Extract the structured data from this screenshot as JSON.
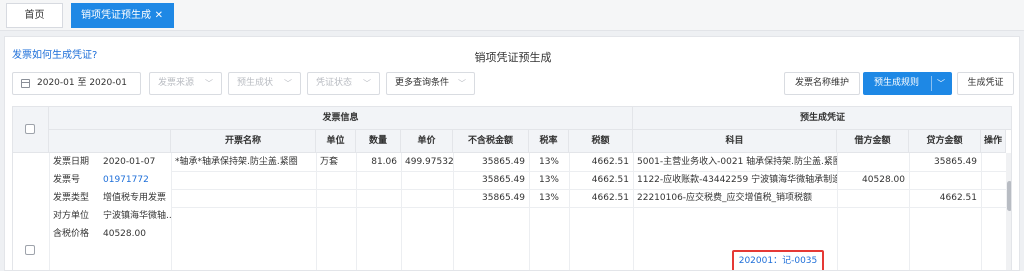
{
  "tabs": {
    "home": "首页",
    "active": "销项凭证预生成",
    "close": "✕"
  },
  "help_link": "发票如何生成凭证?",
  "page_title": "销项凭证预生成",
  "filters": {
    "date_range": "2020-01  至 2020-01",
    "invoice_source": "发票来源",
    "pregen_status": "预生成状",
    "voucher_status": "凭证状态",
    "more_query": "更多查询条件"
  },
  "buttons": {
    "name_maintenance": "发票名称维护",
    "pregen_rule": "预生成规则",
    "generate_voucher": "生成凭证"
  },
  "table": {
    "group_invoice": "发票信息",
    "group_voucher": "预生成凭证",
    "columns": {
      "item_name": "开票名称",
      "unit": "单位",
      "quantity": "数量",
      "unit_price": "单价",
      "amount_ex_tax": "不含税金额",
      "tax_rate": "税率",
      "tax": "税额",
      "subject": "科目",
      "debit": "借方金额",
      "credit": "贷方金额",
      "action": "操作"
    },
    "invoice_meta": [
      {
        "label": "发票日期",
        "value": "2020-01-07"
      },
      {
        "label": "发票号",
        "value": "01971772"
      },
      {
        "label": "发票类型",
        "value": "增值税专用发票"
      },
      {
        "label": "对方单位",
        "value": "宁波镇海华微轴..."
      },
      {
        "label": "含税价格",
        "value": "40528.00"
      }
    ],
    "rows": [
      {
        "item_name": "*轴承*轴承保持架.防尘盖.紧圈",
        "unit": "万套",
        "quantity": "81.06",
        "unit_price": "499.975327",
        "amount_ex_tax": "35865.49",
        "tax_rate": "13%",
        "tax": "4662.51",
        "subject": "5001-主营业务收入-0021 轴承保持架.防尘盖.紧圈...",
        "debit": "",
        "credit": "35865.49"
      },
      {
        "item_name": "",
        "unit": "",
        "quantity": "",
        "unit_price": "",
        "amount_ex_tax": "35865.49",
        "tax_rate": "13%",
        "tax": "4662.51",
        "subject": "1122-应收账款-43442259 宁波镇海华微轴承制造...",
        "debit": "40528.00",
        "credit": ""
      },
      {
        "item_name": "",
        "unit": "",
        "quantity": "",
        "unit_price": "",
        "amount_ex_tax": "35865.49",
        "tax_rate": "13%",
        "tax": "4662.51",
        "subject": "22210106-应交税费_应交增值税_销项税额",
        "debit": "",
        "credit": "4662.51"
      }
    ],
    "voucher_number": "202001：记-0035"
  }
}
